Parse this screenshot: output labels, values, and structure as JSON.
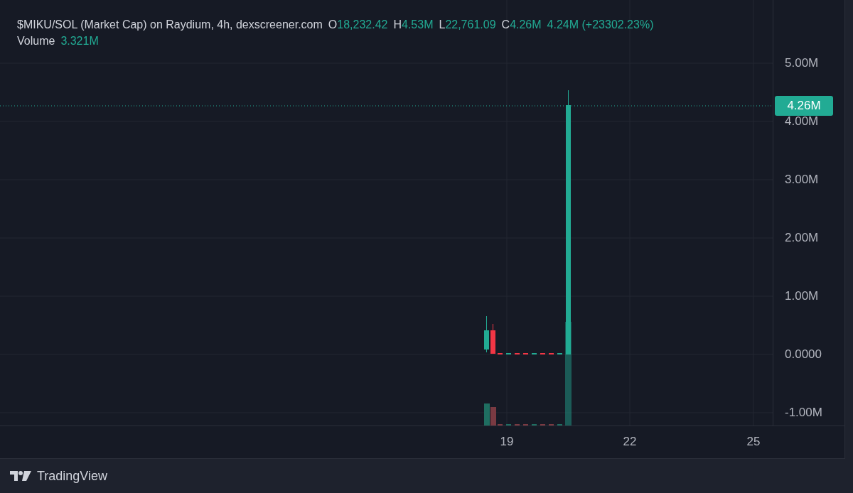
{
  "chart": {
    "symbol": "$MIKU/SOL (Market Cap) on Raydium, 4h, dexscreener.com",
    "ohlc": [
      {
        "key": "O",
        "value": "18,232.42"
      },
      {
        "key": "H",
        "value": "4.53M"
      },
      {
        "key": "L",
        "value": "22,761.09"
      },
      {
        "key": "C",
        "value": "4.26M"
      }
    ],
    "change": "4.24M (+23302.23%)",
    "volume_label": "Volume",
    "volume_value": "3.321M",
    "price_axis": [
      "5.00M",
      "4.00M",
      "3.00M",
      "2.00M",
      "1.00M",
      "0.0000",
      "-1.00M"
    ],
    "last_price": "4.26M",
    "time_axis": [
      "19",
      "22",
      "25"
    ]
  },
  "footer": {
    "brand": "TradingView"
  }
}
